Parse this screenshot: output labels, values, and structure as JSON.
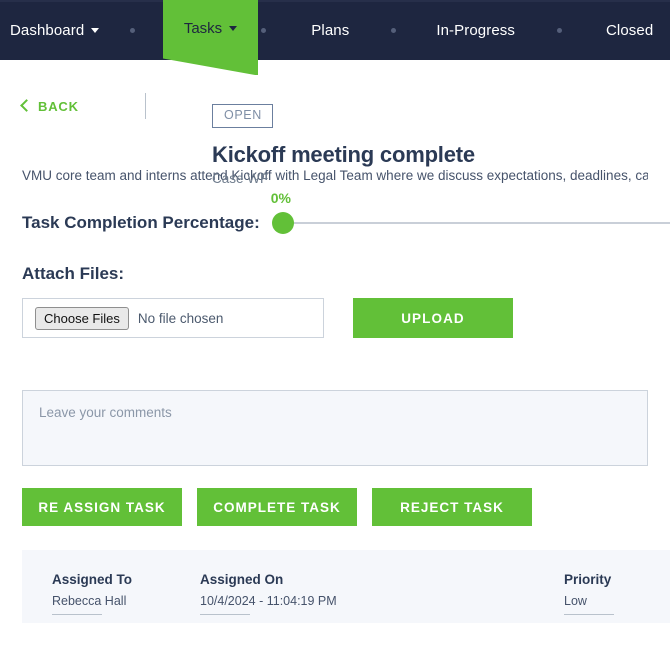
{
  "navbar": {
    "items": [
      {
        "label": "Dashboard",
        "has_caret": true,
        "active": false
      },
      {
        "label": "Tasks",
        "has_caret": true,
        "active": true
      },
      {
        "label": "Plans",
        "has_caret": false,
        "active": false
      },
      {
        "label": "In-Progress",
        "has_caret": false,
        "active": false
      },
      {
        "label": "Closed",
        "has_caret": false,
        "active": false
      }
    ]
  },
  "back": {
    "label": "BACK",
    "icon": "chevron-left-icon"
  },
  "header": {
    "status": "OPEN",
    "title": "Kickoff meeting complete",
    "subtitle": "Case WF"
  },
  "description": "VMU core team and interns attend Kickoff with Legal Team where we discuss expectations, deadlines, case",
  "progress": {
    "label": "Task Completion Percentage:",
    "value_text": "0%",
    "value": 0,
    "min": 0,
    "max": 100
  },
  "attach": {
    "label": "Attach Files:",
    "choose_button": "Choose Files",
    "no_file_text": "No file chosen",
    "upload_button": "UPLOAD"
  },
  "comments": {
    "placeholder": "Leave your comments",
    "value": ""
  },
  "actions": [
    {
      "label": "RE ASSIGN TASK"
    },
    {
      "label": "COMPLETE TASK"
    },
    {
      "label": "REJECT TASK"
    }
  ],
  "info": {
    "assigned_to": {
      "heading": "Assigned To",
      "value": "Rebecca Hall"
    },
    "assigned_on": {
      "heading": "Assigned On",
      "value": "10/4/2024 - 11:04:19 PM"
    },
    "priority": {
      "heading": "Priority",
      "value": "Low"
    }
  },
  "colors": {
    "navy": "#1e2640",
    "green": "#62c038",
    "panel": "#f5f7fb",
    "badge_border": "#6b7f9e"
  }
}
